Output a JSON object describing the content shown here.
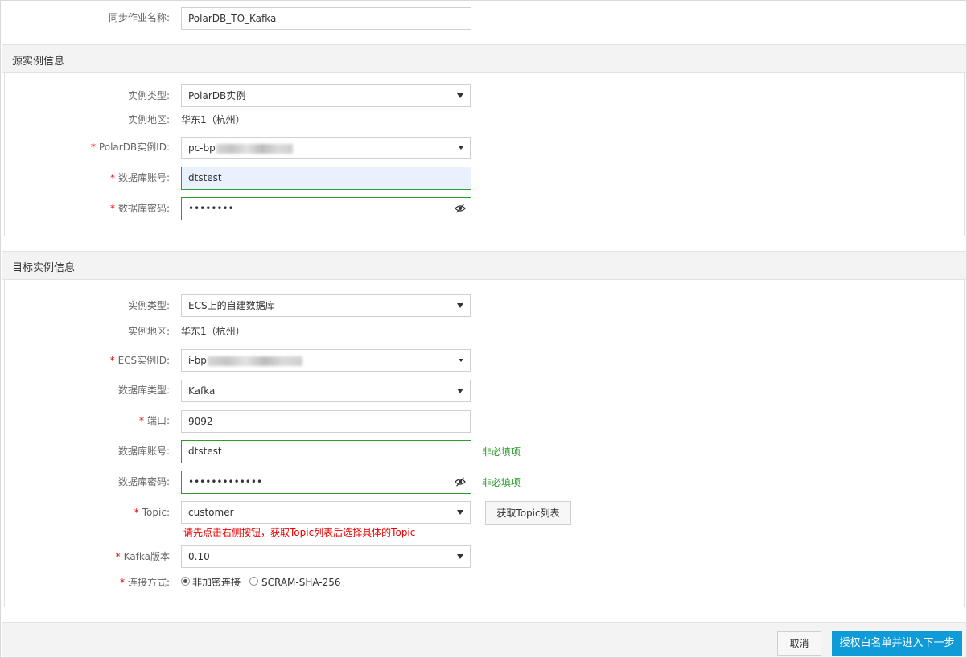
{
  "job": {
    "label": "同步作业名称:",
    "value": "PolarDB_TO_Kafka"
  },
  "source": {
    "title": "源实例信息",
    "instance_type": {
      "label": "实例类型:",
      "value": "PolarDB实例"
    },
    "region": {
      "label": "实例地区:",
      "value": "华东1（杭州）"
    },
    "instance_id": {
      "label": "PolarDB实例ID:",
      "prefix": "pc-bp"
    },
    "db_account": {
      "label": "数据库账号:",
      "value": "dtstest"
    },
    "db_password": {
      "label": "数据库密码:",
      "value": "••••••••"
    }
  },
  "target": {
    "title": "目标实例信息",
    "instance_type": {
      "label": "实例类型:",
      "value": "ECS上的自建数据库"
    },
    "region": {
      "label": "实例地区:",
      "value": "华东1（杭州）"
    },
    "instance_id": {
      "label": "ECS实例ID:",
      "prefix": "i-bp"
    },
    "db_type": {
      "label": "数据库类型:",
      "value": "Kafka"
    },
    "port": {
      "label": "端口:",
      "value": "9092"
    },
    "db_account": {
      "label": "数据库账号:",
      "value": "dtstest",
      "hint": "非必填项"
    },
    "db_password": {
      "label": "数据库密码:",
      "value": "•••••••••••••",
      "hint": "非必填项"
    },
    "topic": {
      "label": "Topic:",
      "value": "customer",
      "button": "获取Topic列表",
      "error": "请先点击右侧按钮，获取Topic列表后选择具体的Topic"
    },
    "kafka_version": {
      "label": "Kafka版本",
      "value": "0.10"
    },
    "connection": {
      "label": "连接方式:",
      "options": [
        "非加密连接",
        "SCRAM-SHA-256"
      ],
      "selected": "非加密连接"
    }
  },
  "footer": {
    "cancel": "取消",
    "next": "授权白名单并进入下一步"
  },
  "colors": {
    "primary": "#0e9bd7",
    "success": "#2c9c2c",
    "error": "#ee0000"
  }
}
